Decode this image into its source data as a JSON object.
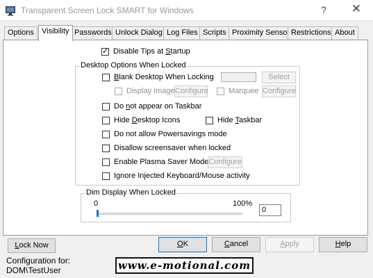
{
  "window": {
    "title": "Transparent Screen Lock SMART for Windows",
    "help_glyph": "?",
    "close_glyph": "✕"
  },
  "tabs": [
    {
      "label": "Options",
      "active": false
    },
    {
      "label": "Visibility",
      "active": true
    },
    {
      "label": "Passwords",
      "active": false
    },
    {
      "label": "Unlock Dialog",
      "active": false
    },
    {
      "label": "Log Files",
      "active": false
    },
    {
      "label": "Scripts",
      "active": false
    },
    {
      "label": "Proximity Sensor",
      "active": false
    },
    {
      "label": "Restrictions",
      "active": false
    },
    {
      "label": "About",
      "active": false
    }
  ],
  "visibility": {
    "disable_tips": {
      "pre": "Disable Tips at ",
      "u": "S",
      "post": "tartup",
      "checked": true
    },
    "desktop_group": {
      "legend": "Desktop Options When Locked",
      "blank_desktop": {
        "u": "B",
        "post": "lank Desktop When Locking",
        "checked": false
      },
      "select_button": "Select",
      "display_image": {
        "label": "Display Image",
        "checked": false
      },
      "configure_image_button": "Configure",
      "marquee": {
        "label": "Marquee",
        "checked": false
      },
      "configure_marquee_button": "Configure",
      "not_taskbar": {
        "pre": "Do ",
        "u": "n",
        "post": "ot appear on Taskbar",
        "checked": false
      },
      "hide_desktop_icons": {
        "pre": "Hide ",
        "u": "D",
        "post": "esktop Icons",
        "checked": false
      },
      "hide_taskbar": {
        "pre": "Hide ",
        "u": "T",
        "post": "askbar",
        "checked": false
      },
      "no_powersave": {
        "label": "Do not allow Powersavings mode",
        "checked": false
      },
      "disallow_screensaver": {
        "label": "Disallow screensaver when locked",
        "checked": false
      },
      "plasma_saver": {
        "label": "Enable Plasma Saver Mode",
        "checked": false
      },
      "configure_plasma_button": "Configure",
      "ignore_injected": {
        "label": "Ignore Injected Keyboard/Mouse activity",
        "checked": false
      }
    },
    "dim_group": {
      "legend": "Dim Display When Locked",
      "min_label": "0",
      "max_label": "100%",
      "value": "0"
    }
  },
  "bottom": {
    "lock_now": {
      "u": "L",
      "post": "ock Now"
    },
    "ok": {
      "u": "O",
      "post": "K"
    },
    "cancel": {
      "u": "C",
      "post": "ancel"
    },
    "apply": {
      "u": "A",
      "post": "pply"
    },
    "help": {
      "u": "H",
      "post": "elp"
    },
    "config_label": "Configuration for:",
    "config_user": "DOM\\TestUser",
    "watermark": "www.e-motional.com"
  },
  "colors": {
    "title_text": "#999999",
    "active_border": "#0078d7",
    "slider_thumb": "#007ad9"
  }
}
